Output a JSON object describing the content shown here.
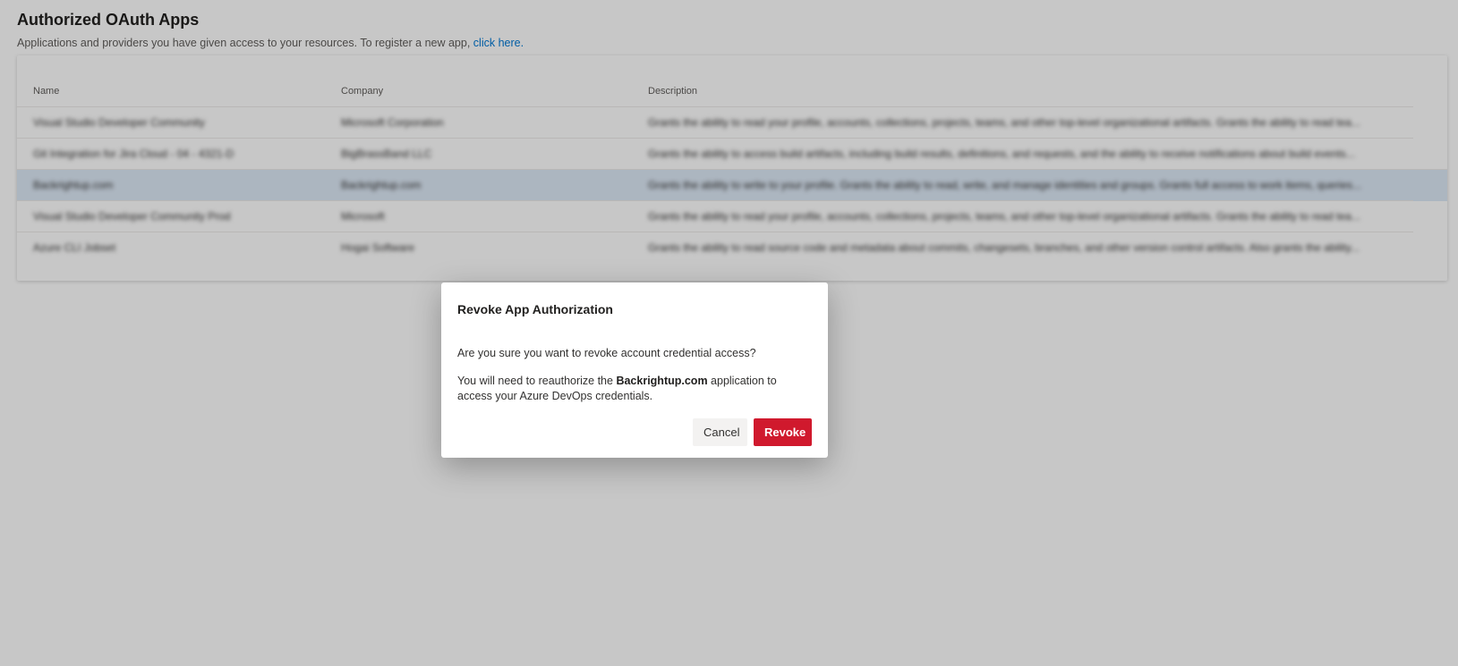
{
  "page": {
    "title": "Authorized OAuth Apps",
    "subtitle": "Applications and providers you have given access to your resources. To register a new app,",
    "subtitle_link": "click here."
  },
  "table": {
    "columns": [
      "Name",
      "Company",
      "Description"
    ],
    "rows": [
      {
        "name": "Visual Studio Developer Community",
        "company": "Microsoft Corporation",
        "description": "Grants the ability to read your profile, accounts, collections, projects, teams, and other top-level organizational artifacts. Grants the ability to read tea...",
        "selected": false
      },
      {
        "name": "Git Integration for Jira Cloud - 04 - 4321-D",
        "company": "BigBrassBand LLC",
        "description": "Grants the ability to access build artifacts, including build results, definitions, and requests, and the ability to receive notifications about build events...",
        "selected": false
      },
      {
        "name": "Backrightup.com",
        "company": "Backrightup.com",
        "description": "Grants the ability to write to your profile. Grants the ability to read, write, and manage identities and groups. Grants full access to work items, queries...",
        "selected": true
      },
      {
        "name": "Visual Studio Developer Community Prod",
        "company": "Microsoft",
        "description": "Grants the ability to read your profile, accounts, collections, projects, teams, and other top-level organizational artifacts. Grants the ability to read tea...",
        "selected": false
      },
      {
        "name": "Azure CLI Jobset",
        "company": "Hogai Software",
        "description": "Grants the ability to read source code and metadata about commits, changesets, branches, and other version control artifacts. Also grants the ability...",
        "selected": false
      }
    ]
  },
  "dialog": {
    "title": "Revoke App Authorization",
    "question": "Are you sure you want to revoke account credential access?",
    "detail_prefix": "You will need to reauthorize the",
    "app_name": "Backrightup.com",
    "detail_suffix": "application to access your Azure DevOps credentials.",
    "cancel_label": "Cancel",
    "revoke_label": "Revoke"
  },
  "colors": {
    "link": "#0078d4",
    "revoke_button": "#d0192d",
    "selected_row": "#dde9f6"
  }
}
